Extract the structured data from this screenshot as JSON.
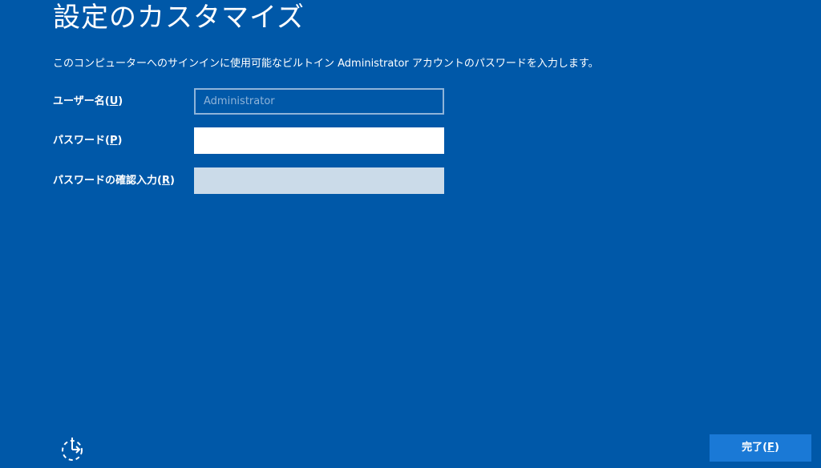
{
  "page": {
    "title": "設定のカスタマイズ",
    "description": "このコンピューターへのサインインに使用可能なビルトイン Administrator アカウントのパスワードを入力します。"
  },
  "fields": {
    "username": {
      "label": "ユーザー名(",
      "accesskey": "U",
      "label_end": ")",
      "value": "Administrator"
    },
    "password": {
      "label": "パスワード(",
      "accesskey": "P",
      "label_end": ")",
      "value": ""
    },
    "confirm": {
      "label": "パスワードの確認入力(",
      "accesskey": "R",
      "label_end": ")",
      "value": ""
    }
  },
  "footer": {
    "ease_of_access_icon": "ease-of-access-icon",
    "finish": {
      "label": "完了(",
      "accesskey": "F",
      "label_end": ")"
    }
  },
  "colors": {
    "background": "#0058a8",
    "button": "#1a79d6",
    "disabled_input": "#cbdbe9"
  }
}
